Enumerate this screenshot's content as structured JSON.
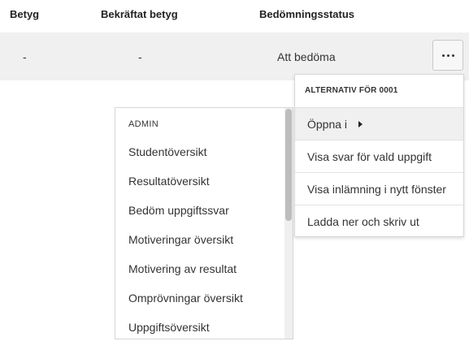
{
  "table": {
    "headers": [
      "Betyg",
      "Bekräftat betyg",
      "Bedömningsstatus"
    ],
    "row": {
      "betyg": "-",
      "bekraftat_betyg": "-",
      "status": "Att bedöma"
    },
    "more_button_icon": "more-horizontal-icon"
  },
  "admin_menu": {
    "section": "ADMIN",
    "items": [
      "Studentöversikt",
      "Resultatöversikt",
      "Bedöm uppgiftssvar",
      "Motiveringar översikt",
      "Motivering av resultat",
      "Omprövningar översikt",
      "Uppgiftsöversikt"
    ]
  },
  "options_menu": {
    "title": "ALTERNATIV FÖR 0001",
    "items": [
      "Öppna i",
      "Visa svar för vald uppgift",
      "Visa inlämning i nytt fönster",
      "Ladda ner och skriv ut"
    ],
    "submenu_icon": "caret-right-icon"
  }
}
